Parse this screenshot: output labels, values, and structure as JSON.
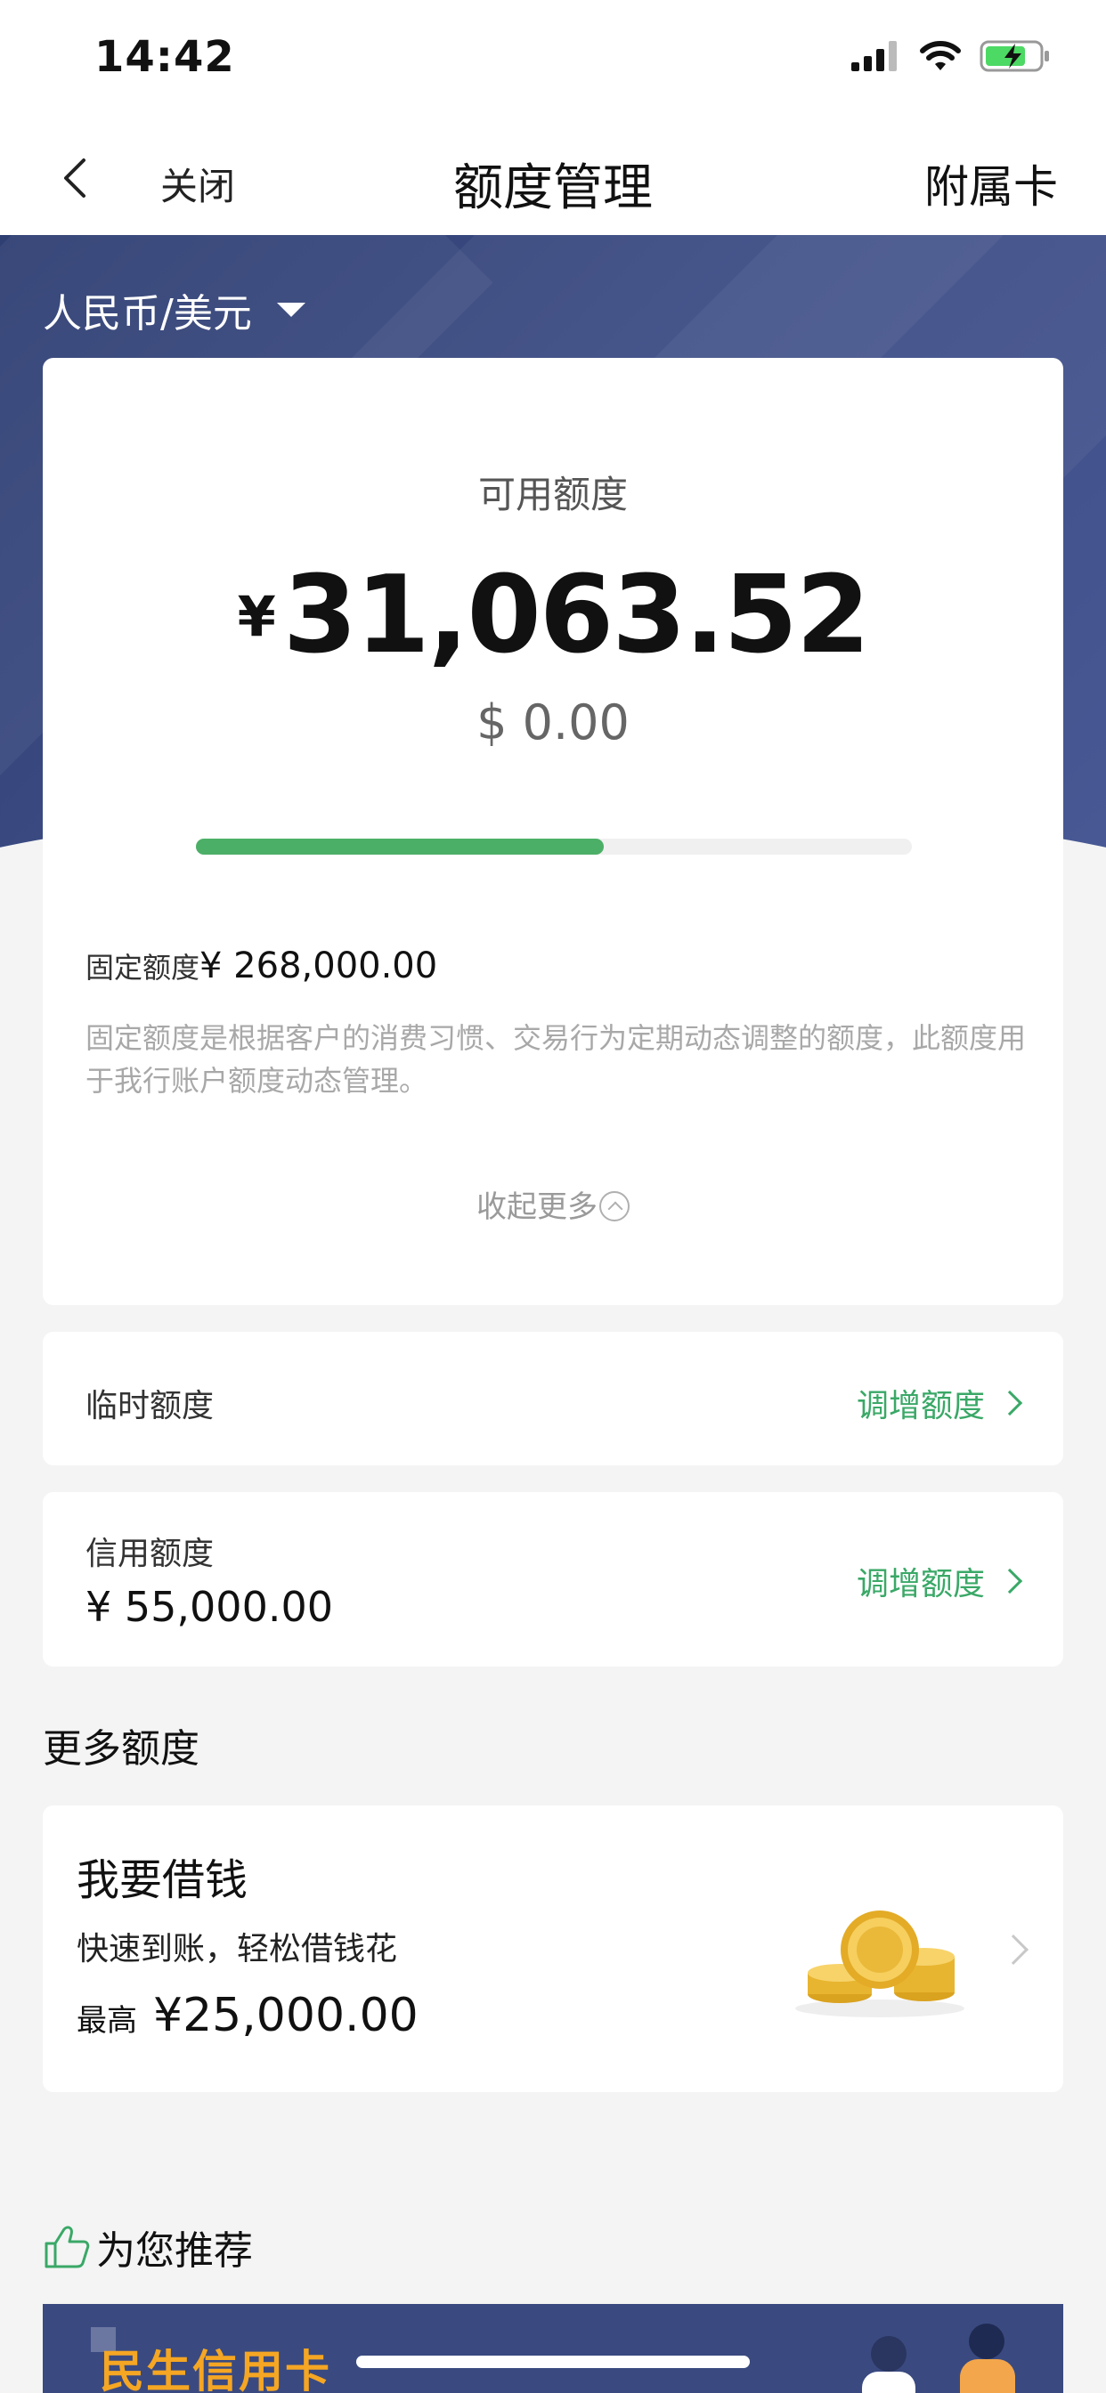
{
  "status_bar": {
    "time": "14:42"
  },
  "nav": {
    "close_label": "关闭",
    "title": "额度管理",
    "right_label": "附属卡"
  },
  "currency": {
    "selected": "人民币/美元"
  },
  "available": {
    "label": "可用额度",
    "currency_symbol": "¥",
    "amount": "31,063.52",
    "usd_amount": "$ 0.00",
    "progress_fraction": 0.57,
    "progress_color": "#4caf67"
  },
  "fixed_limit": {
    "label": "固定额度",
    "amount": "¥ 268,000.00",
    "description": "固定额度是根据客户的消费习惯、交易行为定期动态调整的额度，此额度用于我行账户额度动态管理。"
  },
  "collapse_label": "收起更多",
  "temporary": {
    "label": "临时额度",
    "action": "调增额度"
  },
  "credit": {
    "label": "信用额度",
    "amount": "¥ 55,000.00",
    "action": "调增额度"
  },
  "more_title": "更多额度",
  "loan": {
    "title": "我要借钱",
    "subtitle": "快速到账，轻松借钱花",
    "max_label": "最高",
    "max_amount": "¥25,000.00",
    "icon": "gold-coins-icon"
  },
  "recommend": {
    "title": "为您推荐",
    "icon": "thumbs-up-icon"
  },
  "banner": {
    "text": "民生信用卡"
  },
  "colors": {
    "accent_green": "#3aa867",
    "header_navy": "#3c4c84"
  }
}
